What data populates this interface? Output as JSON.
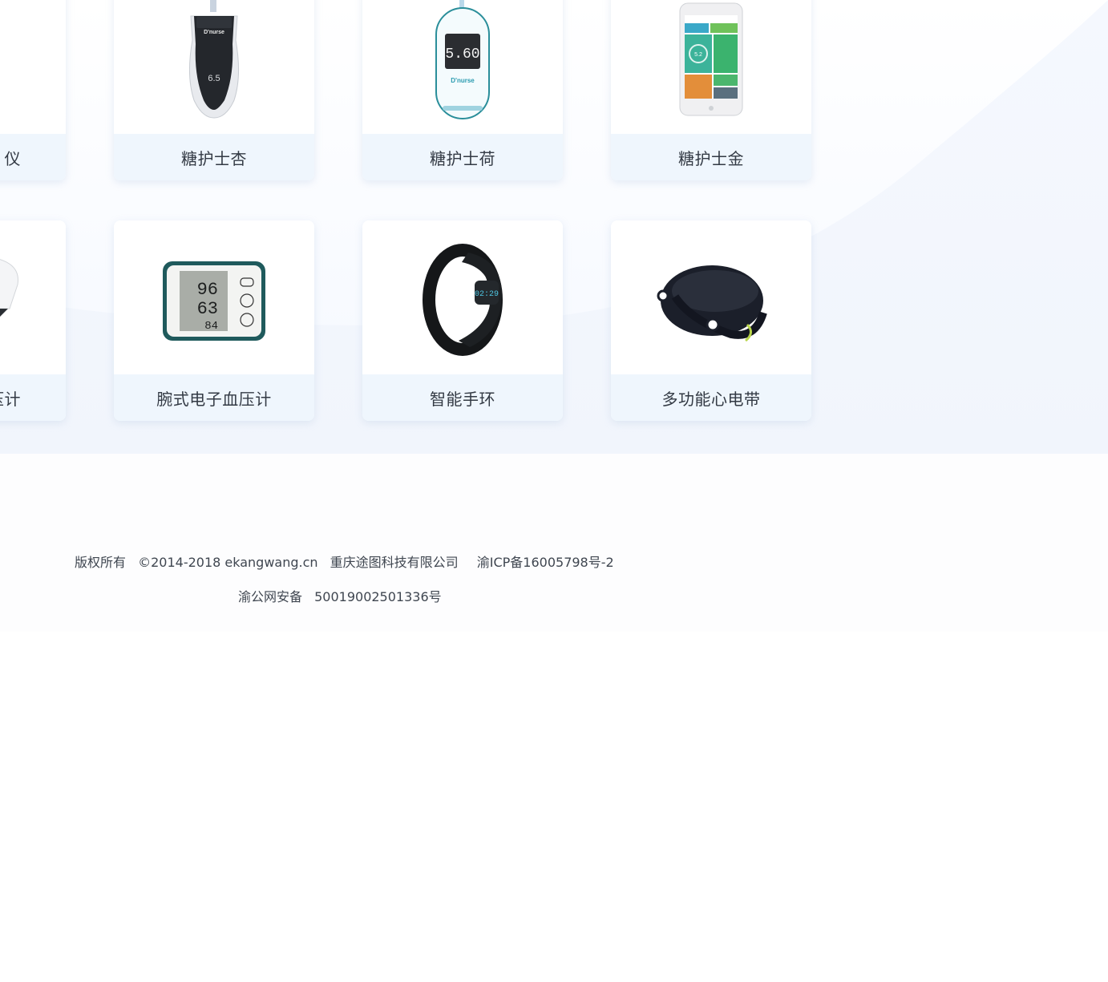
{
  "products": {
    "row1": [
      {
        "label": "仪",
        "icon": "device-partial-icon"
      },
      {
        "label": "糖护士杏",
        "icon": "glucose-meter-black-icon"
      },
      {
        "label": "糖护士荷",
        "icon": "glucose-meter-white-icon"
      },
      {
        "label": "糖护士金",
        "icon": "smart-glucose-phone-icon"
      }
    ],
    "row2": [
      {
        "label": "压计",
        "icon": "arm-cuff-partial-icon"
      },
      {
        "label": "腕式电子血压计",
        "icon": "wrist-blood-pressure-monitor-icon"
      },
      {
        "label": "智能手环",
        "icon": "smart-band-icon"
      },
      {
        "label": "多功能心电带",
        "icon": "ecg-chest-strap-icon"
      }
    ]
  },
  "device_readouts": {
    "meter_black_value": "6.5",
    "meter_white_value": "5.60",
    "phone_value": "5.2",
    "bp_sys": "96",
    "bp_dia": "63",
    "bp_pulse": "84",
    "band_time": "02:29"
  },
  "footer": {
    "copyright_label": "版权所有",
    "copyright_years": "©2014-2018 ekangwang.cn",
    "company": "重庆途图科技有限公司",
    "icp": "渝ICP备16005798号-2",
    "police_label": "渝公网安备",
    "police_number": "50019002501336号"
  },
  "colors": {
    "label_bg": "#eff6fd",
    "label_text": "#333a44",
    "arc_bg": "#f2f6fd",
    "footer_text": "#3f4650"
  }
}
